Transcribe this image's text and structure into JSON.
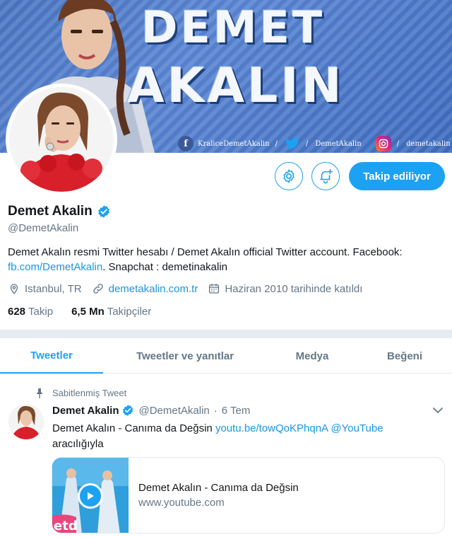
{
  "banner": {
    "line1": "DEMET",
    "line2": "AKALIN",
    "social": [
      {
        "icon": "facebook-icon",
        "handle": "KraliceDemetAkalin",
        "color": "#3b5998"
      },
      {
        "icon": "twitter-icon",
        "handle": "DemetAkalin",
        "color": "#1da1f2"
      },
      {
        "icon": "instagram-icon",
        "handle": "demetakalin",
        "color": "#c13584"
      }
    ]
  },
  "actions": {
    "follow_label": "Takip ediliyor",
    "settings_icon": "gear-icon",
    "notify_icon": "bell-plus-icon"
  },
  "profile": {
    "name": "Demet Akalin",
    "verified_icon": "verified-badge-icon",
    "handle": "@DemetAkalin",
    "bio_text": "Demet Akalın resmi Twitter hesabı / Demet Akalın official Twitter account. Facebook: ",
    "bio_link": "fb.com/DemetAkalin",
    "bio_rest": ". Snapchat : demetinakalin",
    "location": "Istanbul, TR",
    "website": "demetakalin.com.tr",
    "joined": "Haziran 2010 tarihinde katıldı",
    "following_count": "628",
    "following_label": "Takip",
    "followers_count": "6,5 Mn",
    "followers_label": "Takipçiler"
  },
  "tabs": [
    {
      "label": "Tweetler",
      "active": true
    },
    {
      "label": "Tweetler ve yanıtlar",
      "active": false
    },
    {
      "label": "Medya",
      "active": false
    },
    {
      "label": "Beğeni",
      "active": false
    }
  ],
  "tweet": {
    "pinned_label": "Sabitlenmiş Tweet",
    "author": "Demet Akalin",
    "handle": "@DemetAkalin",
    "separator": "·",
    "time": "6 Tem",
    "text_start": "Demet Akalın - Canıma da Değsin ",
    "link": "youtu.be/towQoKPhqnA",
    "mention": "@YouTube",
    "text_end": "aracılığıyla",
    "card": {
      "title": "Demet Akalın - Canıma da Değsin",
      "domain": "www.youtube.com",
      "thumb_logo": "etd"
    }
  },
  "colors": {
    "accent": "#1da1f2",
    "link": "#1b95e0",
    "muted": "#657786"
  }
}
